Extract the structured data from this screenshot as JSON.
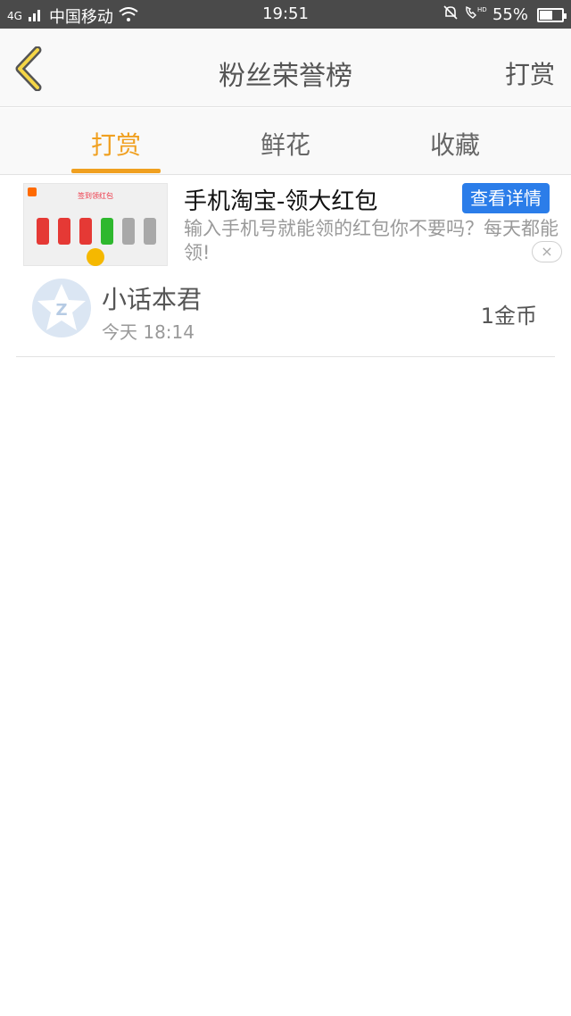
{
  "status_bar": {
    "network": "4G",
    "carrier": "中国移动",
    "time": "19:51",
    "battery": "55%",
    "battery_level": 0.55
  },
  "header": {
    "title": "粉丝荣誉榜",
    "action_label": "打赏",
    "back_icon": "chevron-left-icon"
  },
  "tabs": [
    {
      "label": "打赏",
      "active": true
    },
    {
      "label": "鲜花",
      "active": false
    },
    {
      "label": "收藏",
      "active": false
    }
  ],
  "ad": {
    "thumb_title": "签到领红包",
    "title": "手机淘宝-领大红包",
    "button_label": "查看详情",
    "description": "输入手机号就能领的红包你不要吗？每天都能领!",
    "close_label": "×"
  },
  "list": [
    {
      "name": "小话本君",
      "time": "今天 18:14",
      "amount": "1金币"
    }
  ],
  "colors": {
    "accent": "#f0a020",
    "status_bar": "#4a4a4a",
    "ad_button": "#2b7de9"
  }
}
